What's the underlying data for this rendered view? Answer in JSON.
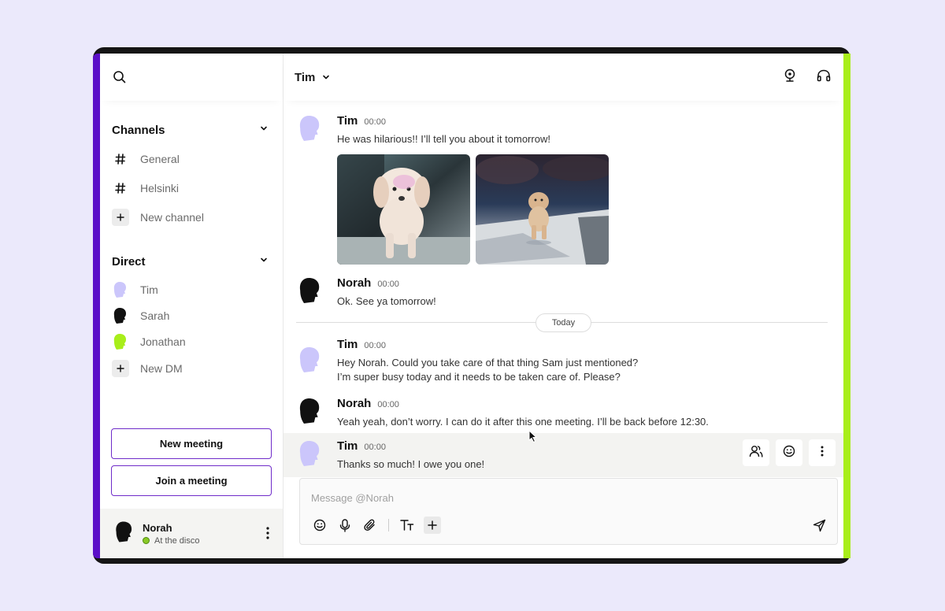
{
  "sidebar": {
    "channels_title": "Channels",
    "channels": [
      {
        "label": "General"
      },
      {
        "label": "Helsinki"
      },
      {
        "label": "New channel"
      }
    ],
    "direct_title": "Direct",
    "direct": [
      {
        "label": "Tim",
        "avatar_color": "#cbc6fb"
      },
      {
        "label": "Sarah",
        "avatar_color": "#111111"
      },
      {
        "label": "Jonathan",
        "avatar_color": "#a8ee1a"
      },
      {
        "label": "New DM"
      }
    ],
    "new_meeting_label": "New meeting",
    "join_meeting_label": "Join a meeting",
    "user": {
      "name": "Norah",
      "status": "At the disco",
      "status_color": "#8ac926"
    }
  },
  "conversation": {
    "title": "Tim",
    "messages": [
      {
        "author": "Tim",
        "time": "00:00",
        "text": "He was hilarious!! I’ll tell you about it tomorrow!"
      },
      {
        "author": "Norah",
        "time": "00:00",
        "text": "Ok. See ya tomorrow!"
      },
      {
        "author": "Tim",
        "time": "00:00",
        "text_line1": "Hey Norah. Could you take care of that thing Sam just mentioned?",
        "text_line2": "I’m super busy today and it needs to be taken care of. Please?"
      },
      {
        "author": "Norah",
        "time": "00:00",
        "text": "Yeah yeah, don’t worry. I can do it after this one meeting. I’ll be back before 12:30."
      },
      {
        "author": "Tim",
        "time": "00:00",
        "text": "Thanks so much! I owe you one!"
      }
    ],
    "divider_label": "Today",
    "composer_placeholder": "Message @Norah"
  },
  "colors": {
    "accent_purple": "#5b10c8",
    "accent_green": "#a8ee1a",
    "tim_avatar": "#cbc6fb",
    "norah_avatar": "#111111"
  }
}
